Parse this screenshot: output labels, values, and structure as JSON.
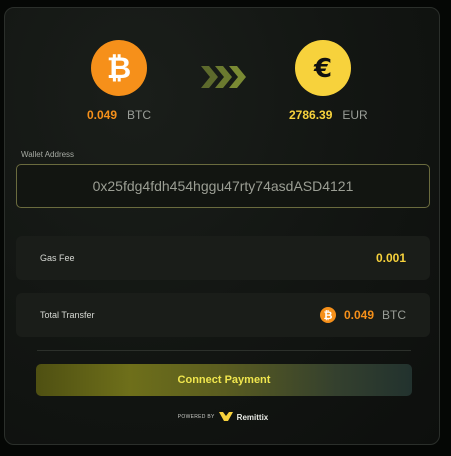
{
  "conversion": {
    "from": {
      "amount": "0.049",
      "currency": "BTC",
      "icon": "bitcoin-icon",
      "color": "#f6901a"
    },
    "to": {
      "amount": "2786.39",
      "currency": "EUR",
      "icon": "euro-icon",
      "color": "#f7d23c"
    },
    "arrow_icon": "triple-chevron-right-icon"
  },
  "wallet": {
    "label": "Wallet Address",
    "value": "0x25fdg4fdh454hggu47rty74asdASD4121"
  },
  "gas_fee": {
    "label": "Gas Fee",
    "value": "0.001"
  },
  "total_transfer": {
    "label": "Total Transfer",
    "amount": "0.049",
    "currency": "BTC"
  },
  "connect_button": {
    "label": "Connect Payment"
  },
  "footer": {
    "powered_by": "POWERED BY",
    "brand": "Remittix"
  },
  "colors": {
    "accent_yellow": "#f7d23c",
    "bitcoin_orange": "#f6901a",
    "button_text": "#f0e64e"
  }
}
